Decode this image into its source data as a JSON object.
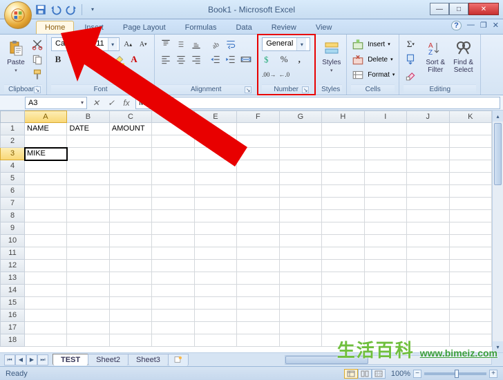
{
  "title": "Book1 - Microsoft Excel",
  "tabs": [
    "Home",
    "Insert",
    "Page Layout",
    "Formulas",
    "Data",
    "Review",
    "View"
  ],
  "active_tab": 0,
  "ribbon": {
    "clipboard": {
      "name": "Clipboard",
      "paste": "Paste"
    },
    "font": {
      "name": "Font",
      "face": "Calibri",
      "size": "11"
    },
    "alignment": {
      "name": "Alignment"
    },
    "number": {
      "name": "Number",
      "format": "General"
    },
    "styles": {
      "name": "Styles",
      "btn": "Styles"
    },
    "cells": {
      "name": "Cells",
      "insert": "Insert",
      "delete": "Delete",
      "format": "Format"
    },
    "editing": {
      "name": "Editing",
      "sort": "Sort &\nFilter",
      "find": "Find &\nSelect"
    }
  },
  "namebox": "A3",
  "formula_value": "MIKE",
  "columns": [
    "A",
    "B",
    "C",
    "D",
    "E",
    "F",
    "G",
    "H",
    "I",
    "J",
    "K"
  ],
  "rows": [
    "1",
    "2",
    "3",
    "4",
    "5",
    "6",
    "7",
    "8",
    "9",
    "10",
    "11",
    "12",
    "13",
    "14",
    "15",
    "16",
    "17",
    "18"
  ],
  "active_cell": {
    "col": "A",
    "row": "3"
  },
  "cells": {
    "A1": "NAME",
    "B1": "DATE",
    "C1": "AMOUNT",
    "A3": "MIKE"
  },
  "sheet_tabs": [
    "TEST",
    "Sheet2",
    "Sheet3"
  ],
  "active_sheet": 0,
  "status": "Ready",
  "zoom": "100%",
  "watermark_text": "生活百科",
  "watermark_url": "www.bimeiz.com"
}
